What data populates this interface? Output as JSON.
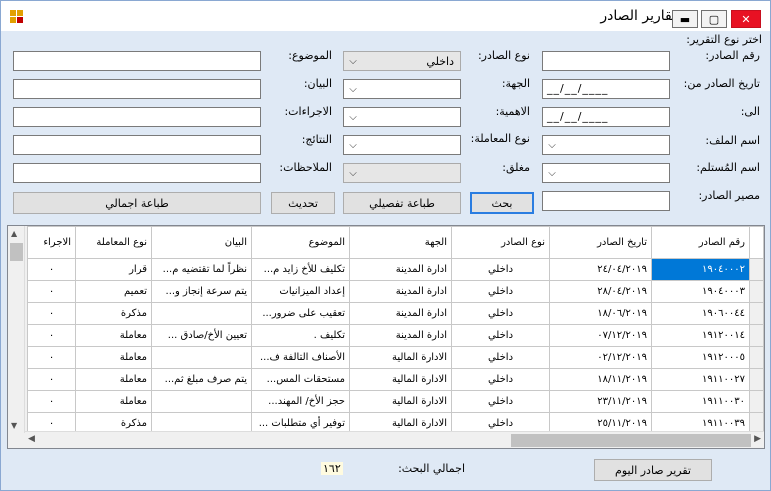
{
  "window": {
    "title": "تقارير الصادر",
    "minimize_glyph": "▬",
    "maximize_glyph": "▢",
    "close_glyph": "✕"
  },
  "form": {
    "report_type_label": "اختر نوع التقرير:",
    "outgoing_no_label": "رقم الصادر:",
    "outgoing_type_label": "نوع الصادر:",
    "outgoing_type_value": "داخلي",
    "subject_label": "الموضوع:",
    "date_from_label": "تاريخ الصادر من:",
    "date_from_value": "__/__/____",
    "party_label": "الجهة:",
    "statement_label": "البيان:",
    "to_label": "الى:",
    "date_to_value": "__/__/____",
    "importance_label": "الاهمية:",
    "procedures_label": "الاجراءات:",
    "file_name_label": "اسم الملف:",
    "transaction_type_label": "نوع المعاملة:",
    "results_label": "النتائج:",
    "recipient_label": "اسم المُستلم:",
    "closed_label": "مغلق:",
    "notes_label": "الملاحظات:",
    "fate_label": "مصير الصادر:",
    "combo_arrow": "⌵"
  },
  "buttons": {
    "search": "بحث",
    "print_detailed": "طباعة تفصيلي",
    "refresh": "تحديث",
    "print_summary": "طباعة اجمالي",
    "today_report": "تقرير صادر اليوم"
  },
  "grid": {
    "columns": [
      "رقم الصادر",
      "تاريخ الصادر",
      "نوع الصادر",
      "الجهة",
      "الموضوع",
      "البيان",
      "نوع المعاملة",
      "الاجراء"
    ],
    "rows": [
      [
        "١٩٠٤٠٠٠٢",
        "٢٤/٠٤/٢٠١٩",
        "داخلي",
        "ادارة المدينة",
        "تكليف للأخ زايد م...",
        "نظراً لما تقتضيه م...",
        "قرار",
        "٠"
      ],
      [
        "١٩٠٤٠٠٠٣",
        "٢٨/٠٤/٢٠١٩",
        "داخلي",
        "ادارة المدينة",
        "إعداد الميزانيات",
        "يتم سرعة إنجاز و...",
        "تعميم",
        "٠"
      ],
      [
        "١٩٠٦٠٠٤٤",
        "١٨/٠٦/٢٠١٩",
        "داخلي",
        "ادارة المدينة",
        "تعقيب على ضرور...",
        "",
        "مذكرة",
        "٠"
      ],
      [
        "١٩١٢٠٠١٤",
        "٠٧/١٢/٢٠١٩",
        "داخلي",
        "ادارة المدينة",
        "تكليف .",
        "تعيين الأخ/صادق ...",
        "معاملة",
        "٠"
      ],
      [
        "١٩١٢٠٠٠٥",
        "٠٢/١٢/٢٠١٩",
        "داخلي",
        "الادارة المالية",
        "الأصناف التالفة ف...",
        "",
        "معاملة",
        "٠"
      ],
      [
        "١٩١١٠٠٢٧",
        "١٨/١١/٢٠١٩",
        "داخلي",
        "الادارة المالية",
        "مستحقات المس...",
        "يتم صرف مبلغ ثم...",
        "معاملة",
        "٠"
      ],
      [
        "١٩١١٠٠٣٠",
        "٢٣/١١/٢٠١٩",
        "داخلي",
        "الادارة المالية",
        "حجز الأخ/ المهند...",
        "",
        "معاملة",
        "٠"
      ],
      [
        "١٩١١٠٠٣٩",
        "٢٥/١١/٢٠١٩",
        "داخلي",
        "الادارة المالية",
        "توفير أي متطلبات ...",
        "",
        "مذكرة",
        "٠"
      ]
    ],
    "up_arrow": "▲",
    "down_arrow": "▼",
    "left_arrow": "◀",
    "right_arrow": "▶"
  },
  "footer": {
    "total_label": "اجمالي البحث:",
    "total_value": "١٦٢"
  }
}
